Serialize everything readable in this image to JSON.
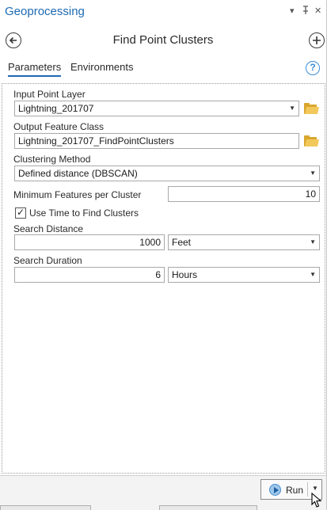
{
  "window": {
    "title": "Geoprocessing",
    "controls": {
      "menu": "▾",
      "pin": "📌",
      "close": "✕"
    }
  },
  "tool": {
    "title": "Find Point Clusters",
    "back_icon": "back-arrow-icon",
    "add_icon": "add-icon"
  },
  "tabs": [
    {
      "label": "Parameters",
      "active": true
    },
    {
      "label": "Environments",
      "active": false
    }
  ],
  "help": {
    "glyph": "?"
  },
  "params": {
    "input_layer": {
      "label": "Input Point Layer",
      "value": "Lightning_201707"
    },
    "output_fc": {
      "label": "Output Feature Class",
      "value": "Lightning_201707_FindPointClusters"
    },
    "method": {
      "label": "Clustering Method",
      "value": "Defined distance (DBSCAN)"
    },
    "min_features": {
      "label": "Minimum Features per Cluster",
      "value": "10"
    },
    "use_time": {
      "label": "Use Time to Find Clusters",
      "checked": true
    },
    "search_distance": {
      "label": "Search Distance",
      "value": "1000",
      "unit": "Feet"
    },
    "search_duration": {
      "label": "Search Duration",
      "value": "6",
      "unit": "Hours"
    }
  },
  "footer": {
    "run_label": "Run"
  },
  "colors": {
    "accent": "#1e6ab4",
    "folder": "#d9a62e",
    "run_icon": "#4a8fcf"
  }
}
